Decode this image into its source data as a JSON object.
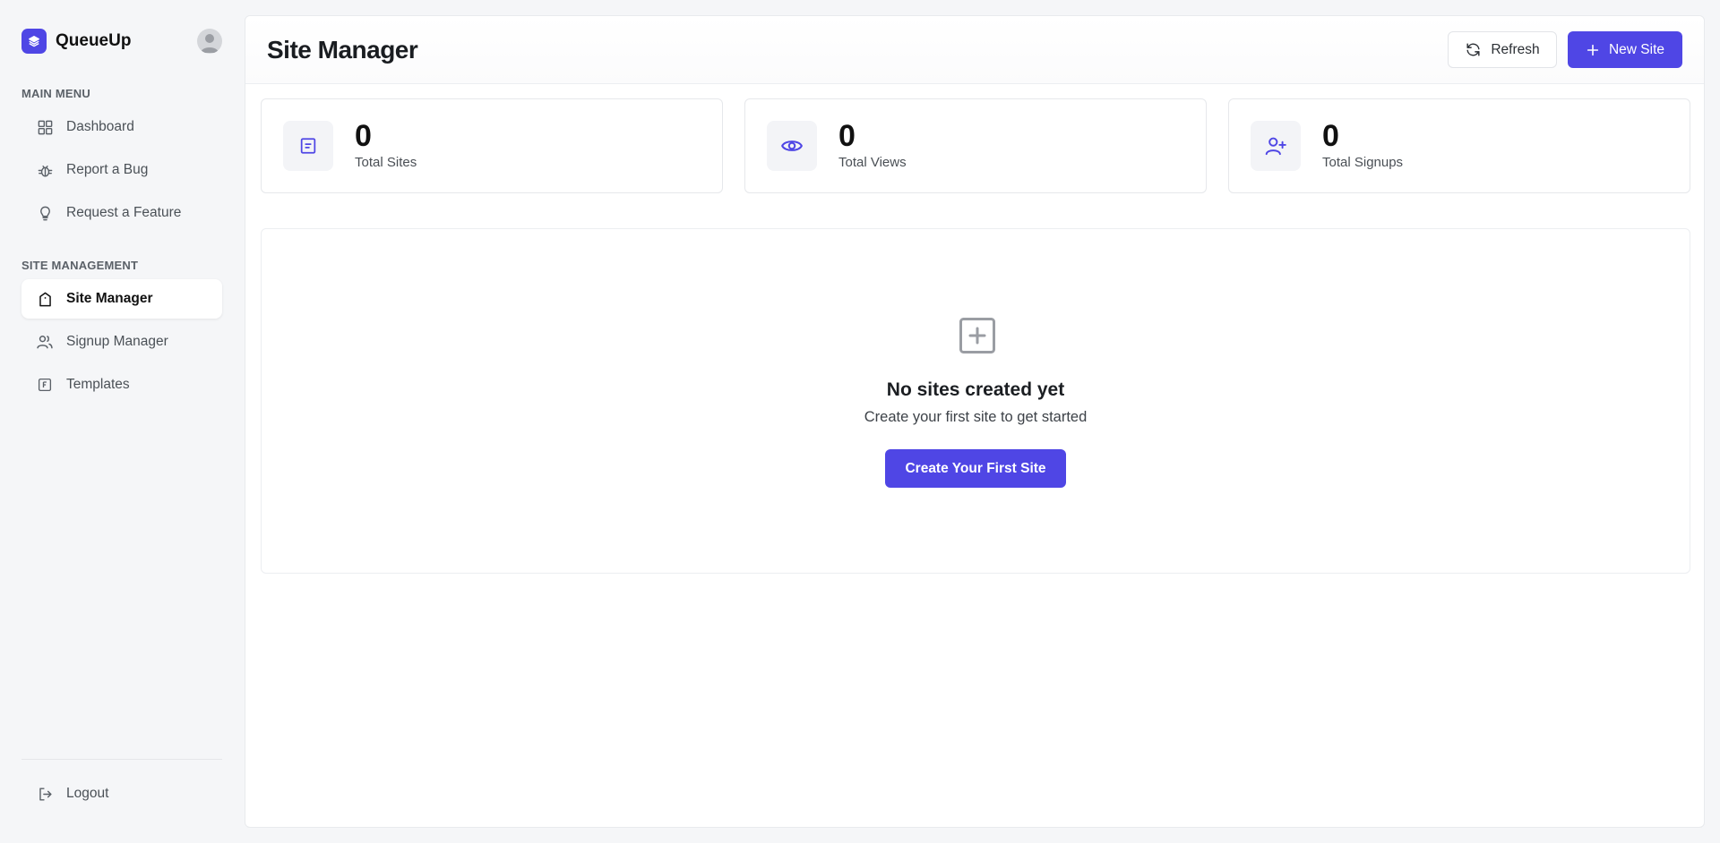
{
  "brand": {
    "name": "QueueUp",
    "accent": "#4f46e5",
    "logo_icon": "layers-icon",
    "avatar_icon": "user-avatar-icon"
  },
  "sidebar": {
    "main_menu_label": "MAIN MENU",
    "main_menu": [
      {
        "label": "Dashboard",
        "icon": "grid-icon"
      },
      {
        "label": "Report a Bug",
        "icon": "bug-icon"
      },
      {
        "label": "Request a Feature",
        "icon": "lightbulb-icon"
      }
    ],
    "site_management_label": "SITE MANAGEMENT",
    "site_management": [
      {
        "label": "Site Manager",
        "icon": "shopping-bag-icon",
        "active": true
      },
      {
        "label": "Signup Manager",
        "icon": "users-icon"
      },
      {
        "label": "Templates",
        "icon": "template-icon"
      }
    ],
    "logout_label": "Logout"
  },
  "header": {
    "title": "Site Manager",
    "refresh_label": "Refresh",
    "new_site_label": "New Site"
  },
  "stats": [
    {
      "value": "0",
      "label": "Total Sites",
      "icon": "document-icon"
    },
    {
      "value": "0",
      "label": "Total Views",
      "icon": "eye-icon"
    },
    {
      "value": "0",
      "label": "Total Signups",
      "icon": "user-plus-icon"
    }
  ],
  "empty_state": {
    "icon": "plus-square-icon",
    "title": "No sites created yet",
    "subtitle": "Create your first site to get started",
    "cta_label": "Create Your First Site"
  }
}
